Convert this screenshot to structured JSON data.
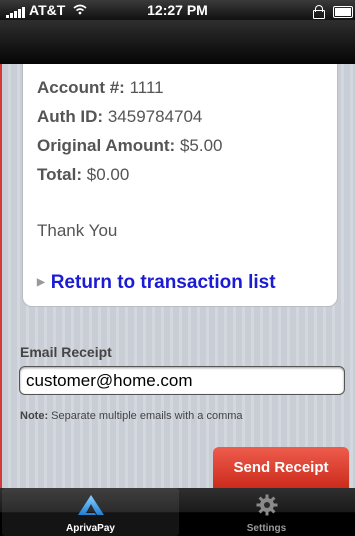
{
  "status_bar": {
    "carrier": "AT&T",
    "time": "12:27 PM"
  },
  "receipt": {
    "account_label": "Account #:",
    "account_value": "1111",
    "auth_label": "Auth ID:",
    "auth_value": "3459784704",
    "original_label": "Original Amount:",
    "original_value": "$5.00",
    "total_label": "Total:",
    "total_value": "$0.00",
    "thank_you": "Thank You",
    "return_link": "Return to transaction list"
  },
  "email": {
    "label": "Email Receipt",
    "value": "customer@home.com",
    "note_label": "Note:",
    "note_text": "Separate multiple emails with a comma",
    "send_label": "Send Receipt"
  },
  "tab_bar": {
    "tabs": [
      {
        "label": "AprivaPay",
        "icon": "apriva-logo-icon",
        "active": true
      },
      {
        "label": "Settings",
        "icon": "gear-icon",
        "active": false
      }
    ]
  },
  "colors": {
    "link": "#1b1bd6",
    "button": "#d93a2b"
  }
}
